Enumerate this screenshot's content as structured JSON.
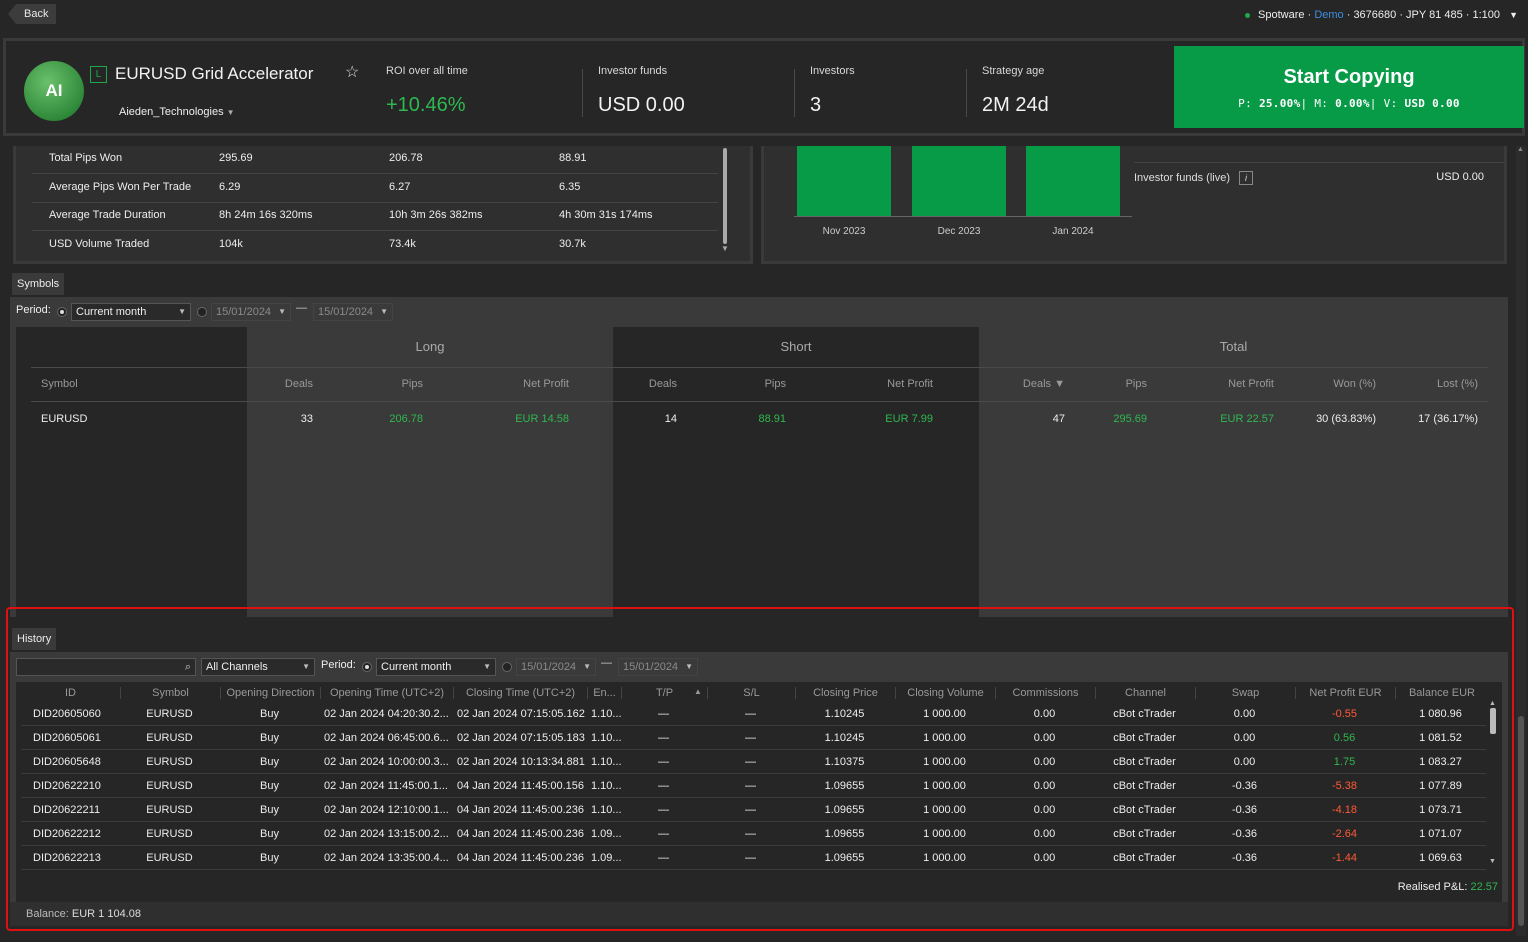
{
  "topbar": {
    "back_label": "Back",
    "broker": "Spotware",
    "account_type": "Demo",
    "account_info": "· 3676680 · JPY 81 485 · 1:100"
  },
  "strategy": {
    "avatar_initials": "AI",
    "badge": "L",
    "name": "EURUSD Grid Accelerator",
    "owner": "Aieden_Technologies"
  },
  "stats": [
    {
      "label": "ROI over all time",
      "value": "+10.46%"
    },
    {
      "label": "Investor funds",
      "value": "USD 0.00"
    },
    {
      "label": "Investors",
      "value": "3"
    },
    {
      "label": "Strategy age",
      "value": "2M 24d"
    }
  ],
  "start_copying": {
    "title": "Start Copying",
    "p_label": "P:",
    "p_value": "25.00%",
    "m_label": "M:",
    "m_value": "0.00%",
    "v_label": "V:",
    "v_value": "USD 0.00"
  },
  "stats_table": {
    "rows": [
      {
        "label": "Total Pips Won",
        "total": "295.69",
        "long": "206.78",
        "short": "88.91"
      },
      {
        "label": "Average Pips Won Per Trade",
        "total": "6.29",
        "long": "6.27",
        "short": "6.35"
      },
      {
        "label": "Average Trade Duration",
        "total": "8h 24m 16s 320ms",
        "long": "10h 3m 26s 382ms",
        "short": "4h 30m 31s 174ms"
      },
      {
        "label": "USD Volume Traded",
        "total": "104k",
        "long": "73.4k",
        "short": "30.7k"
      }
    ]
  },
  "chart_data": {
    "type": "bar",
    "categories": [
      "Nov 2023",
      "Dec 2023",
      "Jan 2024"
    ],
    "title": "",
    "xlabel": "",
    "ylabel": "",
    "color": "#079a47"
  },
  "funds_panel": {
    "label": "Investor funds (live)",
    "value": "USD 0.00",
    "info_icon": "i"
  },
  "symbols": {
    "tab": "Symbols",
    "period_label": "Period:",
    "period_value": "Current month",
    "date_from": "15/01/2024",
    "date_to": "15/01/2024",
    "dash": "—",
    "groups": [
      "Long",
      "Short",
      "Total"
    ],
    "headers": [
      "Symbol",
      "Deals",
      "Pips",
      "Net Profit",
      "Deals",
      "Pips",
      "Net Profit",
      "Deals ▼",
      "Pips",
      "Net Profit",
      "Won (%)",
      "Lost (%)"
    ],
    "row": [
      "EURUSD",
      "33",
      "206.78",
      "EUR 14.58",
      "14",
      "88.91",
      "EUR 7.99",
      "47",
      "295.69",
      "EUR 22.57",
      "30 (63.83%)",
      "17 (36.17%)"
    ]
  },
  "history": {
    "tab": "History",
    "channels_value": "All Channels",
    "period_label": "Period:",
    "period_value": "Current month",
    "date_from": "15/01/2024",
    "date_to": "15/01/2024",
    "dash": "—",
    "headers": [
      "ID",
      "Symbol",
      "Opening Direction",
      "Opening Time (UTC+2)",
      "Closing Time (UTC+2)",
      "En...",
      "T/P",
      "S/L",
      "Closing Price",
      "Closing Volume",
      "Commissions",
      "Channel",
      "Swap",
      "Net Profit EUR",
      "Balance EUR"
    ],
    "rows": [
      [
        "DID20605060",
        "EURUSD",
        "Buy",
        "02 Jan 2024 04:20:30.2...",
        "02 Jan 2024 07:15:05.162",
        "1.10...",
        "—",
        "—",
        "1.10245",
        "1 000.00",
        "0.00",
        "cBot cTrader",
        "0.00",
        "-0.55",
        "1 080.96"
      ],
      [
        "DID20605061",
        "EURUSD",
        "Buy",
        "02 Jan 2024 06:45:00.6...",
        "02 Jan 2024 07:15:05.183",
        "1.10...",
        "—",
        "—",
        "1.10245",
        "1 000.00",
        "0.00",
        "cBot cTrader",
        "0.00",
        "0.56",
        "1 081.52"
      ],
      [
        "DID20605648",
        "EURUSD",
        "Buy",
        "02 Jan 2024 10:00:00.3...",
        "02 Jan 2024 10:13:34.881",
        "1.10...",
        "—",
        "—",
        "1.10375",
        "1 000.00",
        "0.00",
        "cBot cTrader",
        "0.00",
        "1.75",
        "1 083.27"
      ],
      [
        "DID20622210",
        "EURUSD",
        "Buy",
        "02 Jan 2024 11:45:00.1...",
        "04 Jan 2024 11:45:00.156",
        "1.10...",
        "—",
        "—",
        "1.09655",
        "1 000.00",
        "0.00",
        "cBot cTrader",
        "-0.36",
        "-5.38",
        "1 077.89"
      ],
      [
        "DID20622211",
        "EURUSD",
        "Buy",
        "02 Jan 2024 12:10:00.1...",
        "04 Jan 2024 11:45:00.236",
        "1.10...",
        "—",
        "—",
        "1.09655",
        "1 000.00",
        "0.00",
        "cBot cTrader",
        "-0.36",
        "-4.18",
        "1 073.71"
      ],
      [
        "DID20622212",
        "EURUSD",
        "Buy",
        "02 Jan 2024 13:15:00.2...",
        "04 Jan 2024 11:45:00.236",
        "1.09...",
        "—",
        "—",
        "1.09655",
        "1 000.00",
        "0.00",
        "cBot cTrader",
        "-0.36",
        "-2.64",
        "1 071.07"
      ],
      [
        "DID20622213",
        "EURUSD",
        "Buy",
        "02 Jan 2024 13:35:00.4...",
        "04 Jan 2024 11:45:00.236",
        "1.09...",
        "—",
        "—",
        "1.09655",
        "1 000.00",
        "0.00",
        "cBot cTrader",
        "-0.36",
        "-1.44",
        "1 069.63"
      ]
    ],
    "realised_label": "Realised P&L:",
    "realised_value": "22.57",
    "balance_label": "Balance:",
    "balance_value": "EUR 1 104.08"
  },
  "colors": {
    "accent_green": "#079a47",
    "profit_green": "#2fb84f",
    "loss_red": "#ff5a36",
    "highlight_border": "#e01010"
  }
}
